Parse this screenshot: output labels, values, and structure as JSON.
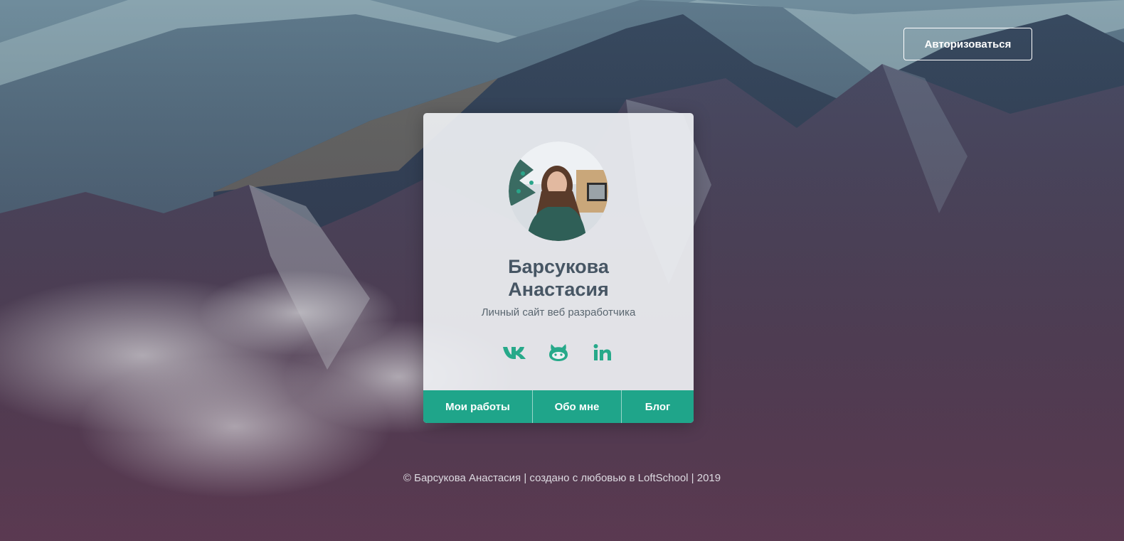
{
  "header": {
    "auth_label": "Авторизоваться"
  },
  "profile": {
    "name_line1": "Барсукова",
    "name_line2": "Анастасия",
    "subtitle": "Личный сайт веб разработчика",
    "avatar_alt": "avatar"
  },
  "socials": [
    {
      "icon": "vk-icon"
    },
    {
      "icon": "github-icon"
    },
    {
      "icon": "linkedin-icon"
    }
  ],
  "nav": {
    "items": [
      {
        "label": "Мои работы"
      },
      {
        "label": "Обо мне"
      },
      {
        "label": "Блог"
      }
    ]
  },
  "footer": {
    "text": "© Барсукова Анастасия | создано с любовью в LoftSchool | 2019"
  },
  "colors": {
    "accent": "#1fa58a",
    "name_text": "#475664"
  }
}
